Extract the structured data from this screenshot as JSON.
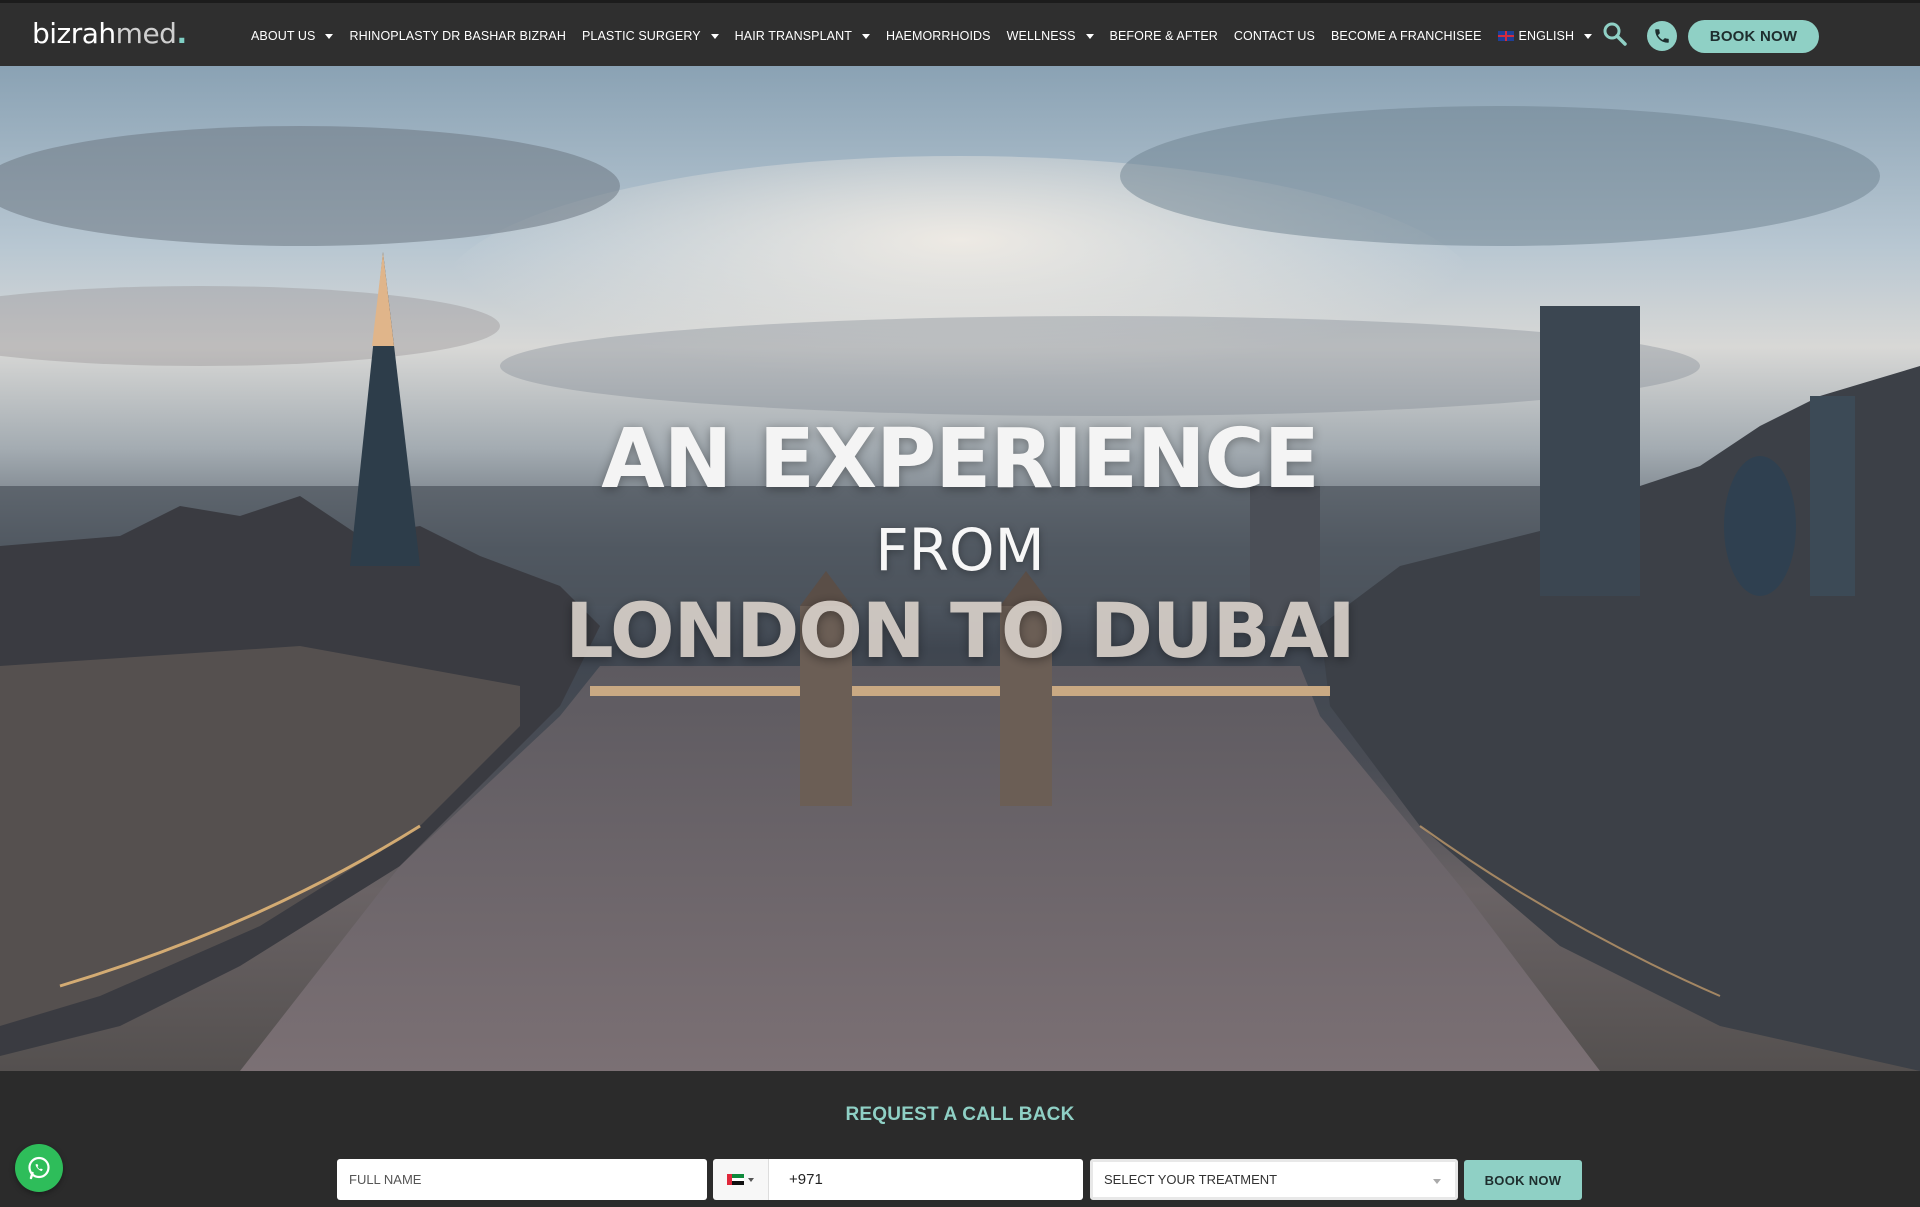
{
  "brand": {
    "logo_part1": "bizrah",
    "logo_part2": "med",
    "logo_dot": "."
  },
  "nav": {
    "items": [
      {
        "label": "ABOUT US",
        "has_dropdown": true
      },
      {
        "label": "RHINOPLASTY DR BASHAR BIZRAH",
        "has_dropdown": false
      },
      {
        "label": "PLASTIC SURGERY",
        "has_dropdown": true
      },
      {
        "label": "HAIR TRANSPLANT",
        "has_dropdown": true
      },
      {
        "label": "HAEMORRHOIDS",
        "has_dropdown": false
      },
      {
        "label": "WELLNESS",
        "has_dropdown": true
      },
      {
        "label": "BEFORE & AFTER",
        "has_dropdown": false
      },
      {
        "label": "CONTACT US",
        "has_dropdown": false
      },
      {
        "label": "BECOME A FRANCHISEE",
        "has_dropdown": false
      }
    ],
    "language": "ENGLISH",
    "book_label": "BOOK NOW"
  },
  "hero": {
    "line1": "AN EXPERIENCE",
    "line2": "FROM",
    "line3": "LONDON TO DUBAI"
  },
  "callback": {
    "title": "REQUEST A CALL BACK",
    "name_placeholder": "FULL NAME",
    "phone_code": "+971",
    "treatment_placeholder": "SELECT YOUR TREATMENT",
    "submit_label": "BOOK NOW"
  },
  "colors": {
    "accent": "#8fd0c5",
    "nav_bg": "#2f2f2f",
    "footer_bg": "#2b2b2b",
    "whatsapp": "#2ebd5a"
  },
  "icons": [
    "search-icon",
    "phone-icon",
    "whatsapp-icon",
    "uk-flag-icon",
    "uae-flag-icon"
  ]
}
